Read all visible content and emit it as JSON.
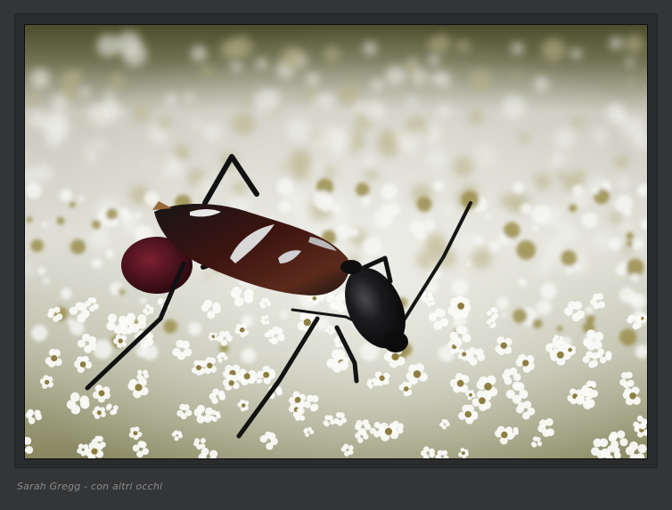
{
  "caption": {
    "text": "Sarah Gregg - con altri occhi"
  },
  "photo": {
    "subject": "longhorn-beetle-on-white-flowers",
    "palette": {
      "page_background": "#343537",
      "frame_background": "#2a2b2d",
      "caption_color": "#8b8b8b",
      "flower_white": "#f4f4f0",
      "bud_brown": "#8a7a3a",
      "beetle_black": "#141414",
      "elytra_red": "#4a1512"
    }
  }
}
